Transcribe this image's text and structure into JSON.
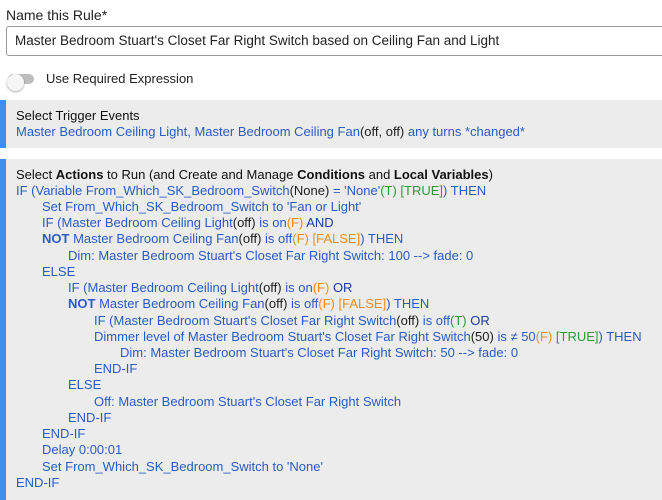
{
  "rule_name": {
    "label": "Name this Rule*",
    "value": "Master Bedroom Stuart's Closet Far Right Switch based on Ceiling Fan and Light"
  },
  "required_expression": {
    "label": "Use Required Expression",
    "enabled": false
  },
  "trigger": {
    "title": "Select Trigger Events",
    "line": {
      "devices": "Master Bedroom Ceiling Light, Master Bedroom Ceiling Fan",
      "state": "(off, off)",
      "suffix": " any turns *changed*"
    }
  },
  "actions": {
    "title": {
      "p1": "Select ",
      "b1": "Actions",
      "p2": " to Run (and Create and Manage ",
      "b2": "Conditions",
      "p3": " and ",
      "b3": "Local Variables",
      "p4": ")"
    },
    "lines": [
      {
        "a": "IF (Variable From_Which_SK_Bedroom_Switch",
        "b": "(None)",
        "c": " = 'None'",
        "d": "(T)",
        "e": " [TRUE]",
        "f": ") THEN"
      },
      {
        "a": "Set From_Which_SK_Bedroom_Switch to 'Fan or Light'"
      },
      {
        "a": "IF (Master Bedroom Ceiling Light",
        "b": "(off)",
        "c": " is on",
        "d": "(F)",
        "e": "  AND"
      },
      {
        "kw": "NOT",
        "a": " Master Bedroom Ceiling Fan",
        "b": "(off)",
        "c": " is off",
        "d": "(F)",
        "e": " [FALSE]",
        "f": ") THEN"
      },
      {
        "a": "Dim: Master Bedroom Stuart's Closet Far Right Switch: 100 --> fade: 0"
      },
      {
        "a": "ELSE"
      },
      {
        "a": "IF (Master Bedroom Ceiling Light",
        "b": "(off)",
        "c": " is on",
        "d": "(F)",
        "e": "  OR"
      },
      {
        "kw": "NOT",
        "a": " Master Bedroom Ceiling Fan",
        "b": "(off)",
        "c": " is off",
        "d": "(F)",
        "e": " [FALSE]",
        "f": ") THEN"
      },
      {
        "a": "IF (Master Bedroom Stuart's Closet Far Right Switch",
        "b": "(off)",
        "c": " is off",
        "d": "(T)",
        "e": "  OR"
      },
      {
        "a": "Dimmer level of Master Bedroom Stuart's Closet Far Right Switch",
        "b": "(50)",
        "c": " is ≠ 50",
        "d": "(F)",
        "e": " [TRUE]",
        "f": ") THEN"
      },
      {
        "a": "Dim: Master Bedroom Stuart's Closet Far Right Switch: 50 --> fade: 0"
      },
      {
        "a": "END-IF"
      },
      {
        "a": "ELSE"
      },
      {
        "a": "Off: Master Bedroom Stuart's Closet Far Right Switch"
      },
      {
        "a": "END-IF"
      },
      {
        "a": "END-IF"
      },
      {
        "a": "Delay 0:00:01"
      },
      {
        "a": "Set From_Which_SK_Bedroom_Switch to 'None'"
      },
      {
        "a": "END-IF"
      }
    ]
  },
  "colors": {
    "accent": "#3a8ff0",
    "link_blue": "#2a5cc2",
    "false_orange": "#ee8d1f",
    "true_green": "#2f9a36",
    "panel_bg": "#ececec"
  }
}
